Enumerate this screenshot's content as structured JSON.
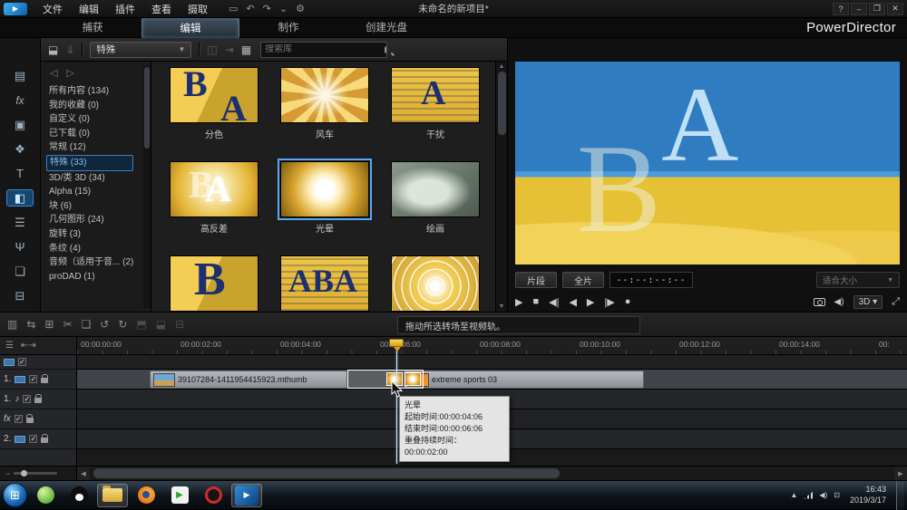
{
  "titlebar": {
    "menus": [
      {
        "label": "文件"
      },
      {
        "label": "编辑"
      },
      {
        "label": "插件"
      },
      {
        "label": "查看"
      },
      {
        "label": "摄取"
      }
    ],
    "project_title": "未命名的新项目*",
    "help": "?",
    "minimize": "–",
    "maximize": "❐",
    "close": "✕"
  },
  "tabs": {
    "capture": "捕获",
    "edit": "编辑",
    "produce": "制作",
    "create_disc": "创建光盘",
    "brand": "PowerDirector"
  },
  "library": {
    "filter_value": "特殊",
    "search_placeholder": "搜索库",
    "categories": [
      {
        "label": "所有内容 (134)"
      },
      {
        "label": "我的收藏 (0)"
      },
      {
        "label": "自定义 (0)"
      },
      {
        "label": "已下载 (0)"
      },
      {
        "label": "常规 (12)"
      },
      {
        "label": "特殊 (33)"
      },
      {
        "label": "3D/类 3D (34)"
      },
      {
        "label": "Alpha (15)"
      },
      {
        "label": "块 (6)"
      },
      {
        "label": "几何图形 (24)"
      },
      {
        "label": "旋转 (3)"
      },
      {
        "label": "条纹 (4)"
      },
      {
        "label": "音频（适用于音... (2)"
      },
      {
        "label": "proDAD (1)"
      }
    ],
    "items": [
      {
        "label": "分色"
      },
      {
        "label": "风车"
      },
      {
        "label": "干扰"
      },
      {
        "label": "高反差"
      },
      {
        "label": "光晕"
      },
      {
        "label": "绘画"
      },
      {
        "label": ""
      },
      {
        "label": ""
      },
      {
        "label": ""
      }
    ]
  },
  "preview": {
    "clip_button": "片段",
    "movie_button": "全片",
    "timecode": "--:--:--:--",
    "quality_dropdown": "适合大小",
    "threed_button": "3D"
  },
  "status_hint": "拖动所选转场至视频轨。",
  "timeline": {
    "ruler_labels": [
      "00:00:00:00",
      "00:00:02:00",
      "00:00:04:00",
      "00:00:06:00",
      "00:00:08:00",
      "00:00:10:00",
      "00:00:12:00",
      "00:00:14:00",
      "00:"
    ],
    "tracks": [
      {
        "label": "1."
      },
      {
        "label": "1."
      },
      {
        "label": "fx"
      },
      {
        "label": "2."
      }
    ],
    "clip1_name": "39107284-1411954415923.mthumb",
    "clip2_name": "extreme sports 03"
  },
  "tooltip": {
    "title": "光晕",
    "start": "起始时间:00:00:04:06",
    "end": "结束时间:00:00:06:06",
    "overlap": "重叠持续时间：  00:00:02:00"
  },
  "taskbar": {
    "time": "16:43",
    "date": "2019/3/17"
  },
  "colors": {
    "accent": "#3d9be9",
    "selection": "#55a9f7",
    "thumbnail_gold": "#e8b838"
  }
}
